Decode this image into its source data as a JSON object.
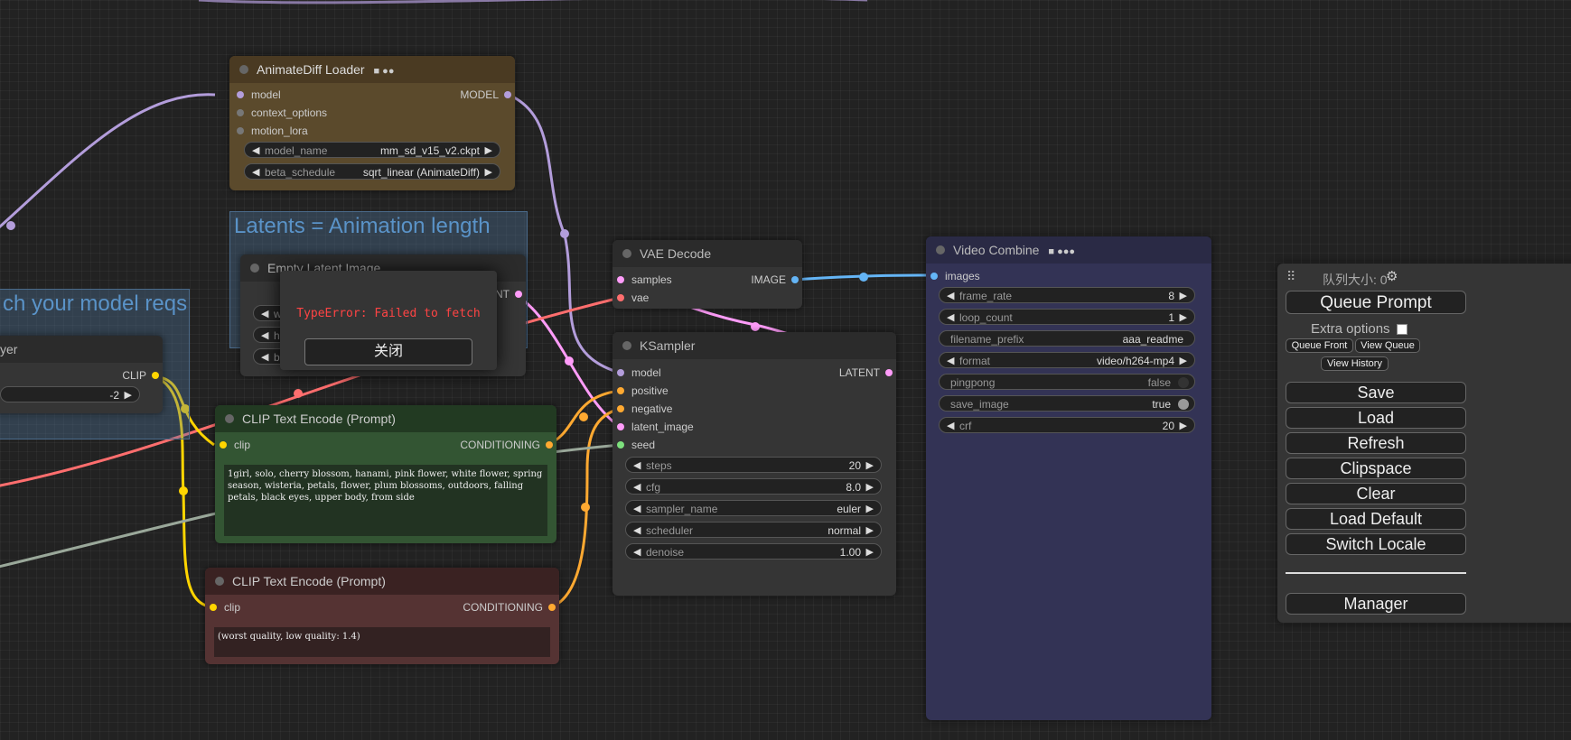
{
  "groups": {
    "latents_title": "Latents = Animation length",
    "model_reqs_title": "ch your model reqs"
  },
  "nodes": {
    "animatediff_loader": {
      "title": "AnimateDiff Loader",
      "inputs": [
        "model",
        "context_options",
        "motion_lora"
      ],
      "output": "MODEL",
      "widgets": [
        {
          "label": "model_name",
          "value": "mm_sd_v15_v2.ckpt"
        },
        {
          "label": "beta_schedule",
          "value": "sqrt_linear (AnimateDiff)"
        }
      ]
    },
    "empty_latent": {
      "title": "Empty Latent Image",
      "output": "LATENT",
      "widgets": [
        "width",
        "height",
        "batch_s"
      ]
    },
    "clip_skip": {
      "title": "yer",
      "output": "CLIP",
      "widget_value": "-2"
    },
    "vae_decode": {
      "title": "VAE Decode",
      "inputs": [
        "samples",
        "vae"
      ],
      "output": "IMAGE"
    },
    "ksampler": {
      "title": "KSampler",
      "inputs": [
        "model",
        "positive",
        "negative",
        "latent_image",
        "seed"
      ],
      "output": "LATENT",
      "widgets": [
        {
          "label": "steps",
          "value": "20"
        },
        {
          "label": "cfg",
          "value": "8.0"
        },
        {
          "label": "sampler_name",
          "value": "euler"
        },
        {
          "label": "scheduler",
          "value": "normal"
        },
        {
          "label": "denoise",
          "value": "1.00"
        }
      ]
    },
    "clip_positive": {
      "title": "CLIP Text Encode (Prompt)",
      "input": "clip",
      "output": "CONDITIONING",
      "text": "1girl, solo, cherry blossom, hanami, pink flower, white flower, spring season, wisteria, petals, flower, plum blossoms, outdoors, falling petals, black eyes, upper body, from side"
    },
    "clip_negative": {
      "title": "CLIP Text Encode (Prompt)",
      "input": "clip",
      "output": "CONDITIONING",
      "text": "(worst quality, low quality: 1.4)"
    },
    "video_combine": {
      "title": "Video Combine",
      "input": "images",
      "widgets": [
        {
          "label": "frame_rate",
          "value": "8"
        },
        {
          "label": "loop_count",
          "value": "1"
        },
        {
          "label": "filename_prefix",
          "value": "aaa_readme"
        },
        {
          "label": "format",
          "value": "video/h264-mp4"
        },
        {
          "label": "pingpong",
          "value": "false"
        },
        {
          "label": "save_image",
          "value": "true"
        },
        {
          "label": "crf",
          "value": "20"
        }
      ]
    }
  },
  "dialog": {
    "message": "TypeError: Failed to fetch",
    "close_label": "关闭"
  },
  "menu": {
    "queue_size": "队列大小: 0",
    "queue_prompt": "Queue Prompt",
    "extra_options": "Extra options",
    "queue_front": "Queue Front",
    "view_queue": "View Queue",
    "view_history": "View History",
    "save": "Save",
    "load": "Load",
    "refresh": "Refresh",
    "clipspace": "Clipspace",
    "clear": "Clear",
    "load_default": "Load Default",
    "switch_locale": "Switch Locale",
    "manager": "Manager"
  },
  "colors": {
    "model_link": "#b39ddb",
    "clip_link": "#ffd500",
    "latent_link": "#ff9cf9",
    "vae_link": "#ff6e6e",
    "conditioning_link": "#ffa931",
    "image_link": "#64b5f6",
    "int_link": "#aaaaaa"
  }
}
